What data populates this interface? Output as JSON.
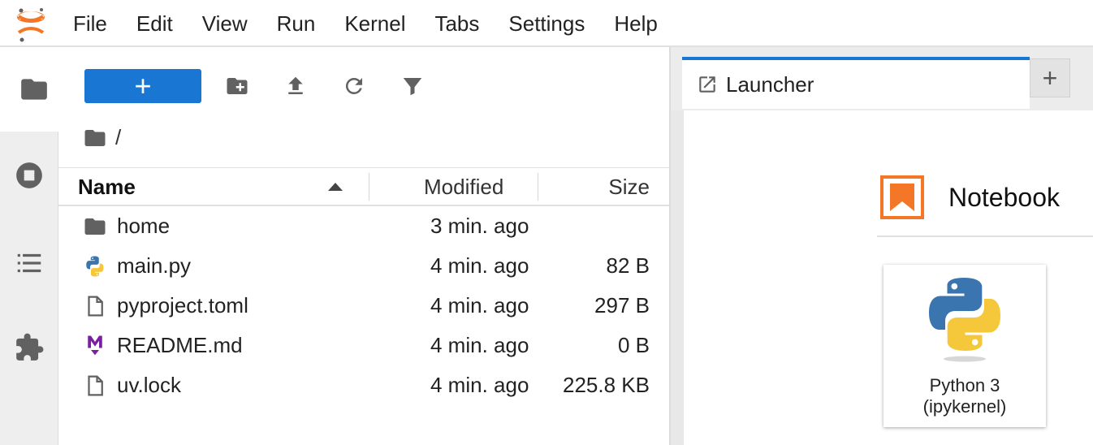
{
  "menu": [
    "File",
    "Edit",
    "View",
    "Run",
    "Kernel",
    "Tabs",
    "Settings",
    "Help"
  ],
  "toolbar": {
    "new_label": "+"
  },
  "breadcrumb": "/",
  "columns": {
    "name": "Name",
    "modified": "Modified",
    "size": "Size"
  },
  "files": [
    {
      "name": "home",
      "modified": "3 min. ago",
      "size": "",
      "icon": "folder-icon"
    },
    {
      "name": "main.py",
      "modified": "4 min. ago",
      "size": "82 B",
      "icon": "python-file-icon"
    },
    {
      "name": "pyproject.toml",
      "modified": "4 min. ago",
      "size": "297 B",
      "icon": "file-icon"
    },
    {
      "name": "README.md",
      "modified": "4 min. ago",
      "size": "0 B",
      "icon": "markdown-icon"
    },
    {
      "name": "uv.lock",
      "modified": "4 min. ago",
      "size": "225.8 KB",
      "icon": "file-icon"
    }
  ],
  "tab": {
    "label": "Launcher",
    "add_label": "+"
  },
  "launcher": {
    "section_title": "Notebook",
    "kernel_line1": "Python 3",
    "kernel_line2": "(ipykernel)"
  },
  "colors": {
    "accent": "#1976d2",
    "jupyter_orange": "#f37726",
    "markdown_purple": "#7b1fa2"
  }
}
